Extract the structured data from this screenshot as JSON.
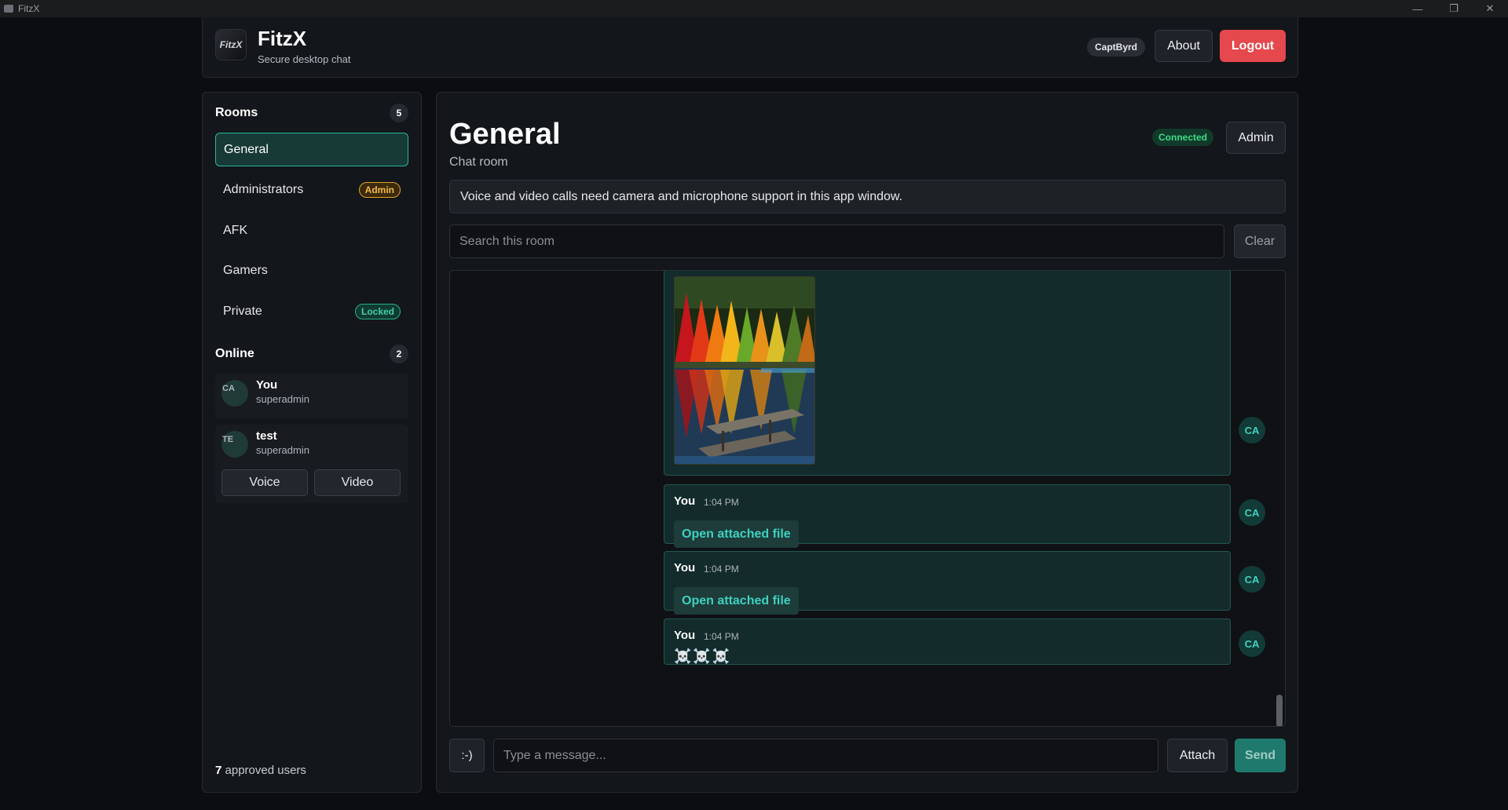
{
  "window": {
    "title": "FitzX",
    "controls": [
      "minimize",
      "restore",
      "close"
    ]
  },
  "header": {
    "logo_text": "FitzX",
    "title": "FitzX",
    "subtitle": "Secure desktop chat",
    "username": "CaptByrd",
    "about_label": "About",
    "logout_label": "Logout"
  },
  "sidebar": {
    "rooms_title": "Rooms",
    "rooms_count": "5",
    "rooms": [
      {
        "label": "General",
        "tag": "",
        "active": true
      },
      {
        "label": "Administrators",
        "tag": "Admin"
      },
      {
        "label": "AFK",
        "tag": ""
      },
      {
        "label": "Gamers",
        "tag": ""
      },
      {
        "label": "Private",
        "tag": "Locked"
      }
    ],
    "online_title": "Online",
    "online_count": "2",
    "online": [
      {
        "initials": "CA",
        "name": "You",
        "role": "superadmin"
      },
      {
        "initials": "TE",
        "name": "test",
        "role": "superadmin",
        "voice_label": "Voice",
        "video_label": "Video"
      }
    ],
    "approved_count": "7",
    "approved_label": "approved users"
  },
  "main": {
    "room_title": "General",
    "room_subtitle": "Chat room",
    "status": "Connected",
    "admin_label": "Admin",
    "notice": "Voice and video calls need camera and microphone support in this app window.",
    "search_placeholder": "Search this room",
    "clear_label": "Clear",
    "messages": [
      {
        "kind": "image",
        "avatar": "CA",
        "image_desc": "autumn-lake-dock-image"
      },
      {
        "kind": "file",
        "author": "You",
        "time": "1:04 PM",
        "file_label": "Open attached file",
        "avatar": "CA"
      },
      {
        "kind": "file",
        "author": "You",
        "time": "1:04 PM",
        "file_label": "Open attached file",
        "avatar": "CA"
      },
      {
        "kind": "text",
        "author": "You",
        "time": "1:04 PM",
        "text": "☠️☠️☠️",
        "avatar": "CA"
      }
    ],
    "composer": {
      "emoji_label": ":-)",
      "placeholder": "Type a message...",
      "attach_label": "Attach",
      "send_label": "Send"
    }
  },
  "colors": {
    "accent": "#2bb5a0",
    "logout": "#e5484d",
    "connected": "#3ddc84",
    "admin_tag": "#e3a328"
  }
}
